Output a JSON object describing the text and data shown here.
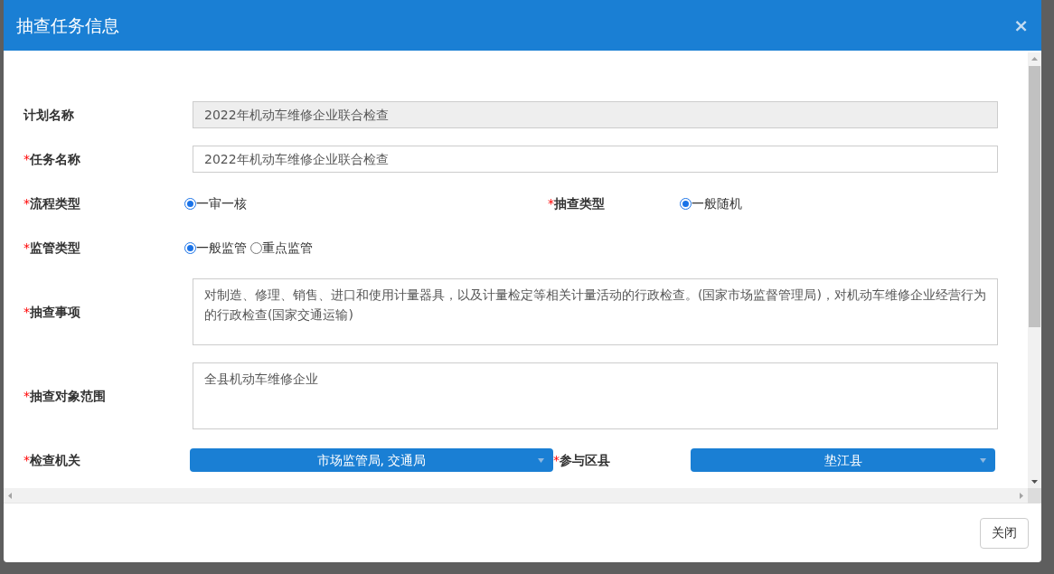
{
  "dialog": {
    "title": "抽查任务信息",
    "close_symbol": "×"
  },
  "form": {
    "rows": [
      {
        "fields": [
          {
            "kind": "text",
            "label": "计划名称",
            "disabled": true,
            "value": "2022年机动车维修企业联合检查"
          }
        ]
      },
      {
        "fields": [
          {
            "kind": "text",
            "label": "任务名称",
            "required_mark": "*",
            "disabled": false,
            "value": "2022年机动车维修企业联合检查"
          }
        ]
      },
      {
        "fields": [
          {
            "kind": "radio",
            "label": "流程类型",
            "required_mark": "*",
            "options": [
              {
                "label": "一审一核",
                "selected": true
              }
            ]
          },
          {
            "kind": "radio",
            "label": "抽查类型",
            "required_mark": "*",
            "options": [
              {
                "label": "一般随机",
                "selected": true
              }
            ]
          }
        ]
      },
      {
        "fields": [
          {
            "kind": "radio",
            "label": "监管类型",
            "required_mark": "*",
            "options": [
              {
                "label": "一般监管",
                "selected": true
              },
              {
                "label": "重点监管",
                "selected": false
              }
            ]
          }
        ]
      },
      {
        "fields": [
          {
            "kind": "textarea",
            "label": "抽查事项",
            "required_mark": "*",
            "disabled": false,
            "value": "对制造、修理、销售、进口和使用计量器具，以及计量检定等相关计量活动的行政检查。(国家市场监督管理局)，对机动车维修企业经营行为的行政检查(国家交通运输)"
          }
        ]
      },
      {
        "fields": [
          {
            "kind": "textarea",
            "label": "抽查对象范围",
            "required_mark": "*",
            "disabled": false,
            "value": "全县机动车维修企业"
          }
        ]
      },
      {
        "fields": [
          {
            "kind": "select",
            "label": "检查机关",
            "required_mark": "*",
            "value": "市场监管局, 交通局"
          },
          {
            "kind": "select",
            "label": "参与区县",
            "required_mark": "*",
            "value": "垫江县"
          }
        ]
      }
    ]
  },
  "footer": {
    "buttons": [
      {
        "label": "关闭"
      }
    ]
  }
}
